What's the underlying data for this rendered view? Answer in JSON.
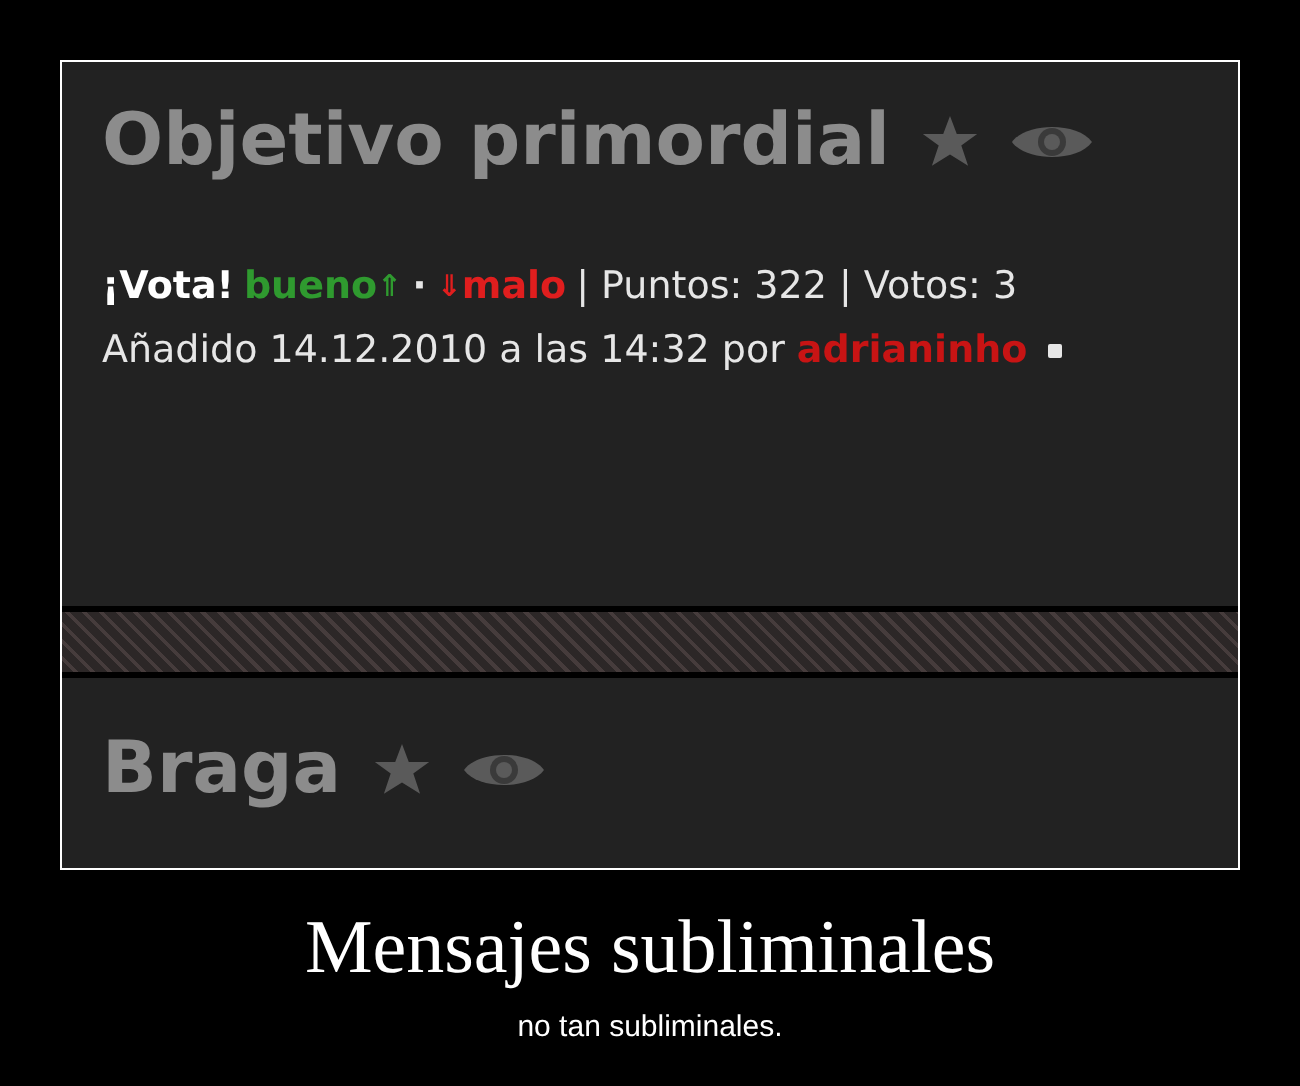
{
  "posts": [
    {
      "title": "Objetivo primordial"
    },
    {
      "title": "Braga"
    }
  ],
  "vote": {
    "label": "¡Vota!",
    "good": "bueno",
    "good_arrow": "⇑",
    "separator": "·",
    "bad_arrow": "⇓",
    "bad": "malo",
    "stats": "| Puntos: 322 | Votos: 3"
  },
  "meta": {
    "text": "Añadido 14.12.2010 a las 14:32 por",
    "author": "adrianinho"
  },
  "caption": {
    "title": "Mensajes subliminales",
    "subtitle": "no tan subliminales."
  }
}
